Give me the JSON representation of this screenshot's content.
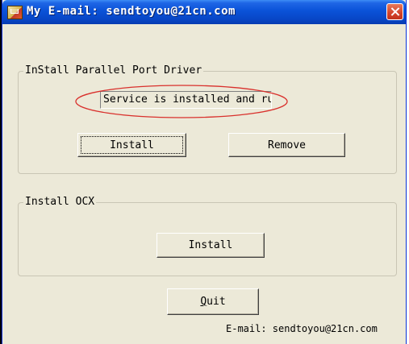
{
  "window": {
    "title": "My E-mail: sendtoyou@21cn.com"
  },
  "driver_group": {
    "label": "InStall Parallel Port Driver",
    "status_text": "Service is installed and running",
    "install_label": "Install",
    "remove_label": "Remove"
  },
  "ocx_group": {
    "label": "Install OCX",
    "install_label": "Install"
  },
  "footer": {
    "quit_prefix": "",
    "quit_mnemonic": "Q",
    "quit_rest": "uit",
    "email": "E-mail: sendtoyou@21cn.com"
  },
  "colors": {
    "titlebar": "#0a52d8",
    "window_bg": "#ece9d8",
    "highlight_ellipse": "#d9302c",
    "close_button": "#d2432a"
  },
  "icons": {
    "app": "mail-app-icon",
    "close": "close-icon"
  }
}
